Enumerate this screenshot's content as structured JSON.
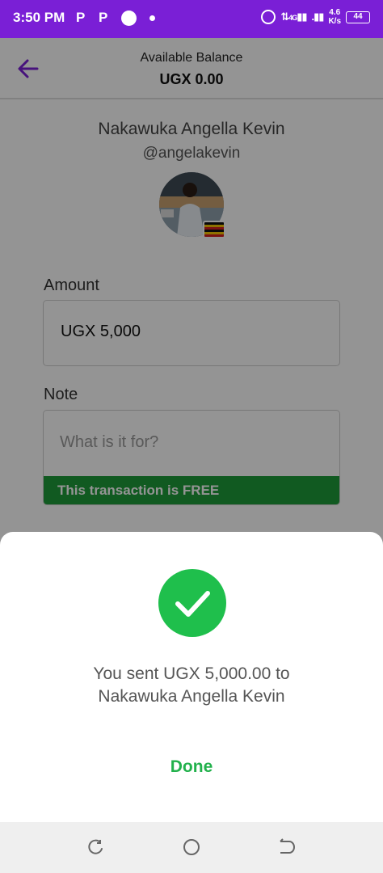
{
  "status_bar": {
    "time": "3:50 PM",
    "p1": "P",
    "p2": "P",
    "network": "4G",
    "speed_value": "4.6",
    "speed_unit": "K/s",
    "battery": "44"
  },
  "header": {
    "balance_label": "Available Balance",
    "balance_value": "UGX 0.00"
  },
  "recipient": {
    "name": "Nakawuka Angella Kevin",
    "handle": "@angelakevin"
  },
  "form": {
    "amount_label": "Amount",
    "amount_value": "UGX 5,000",
    "note_label": "Note",
    "note_placeholder": "What is it for?",
    "free_notice": "This transaction is FREE"
  },
  "dialog": {
    "message_line1": "You sent UGX 5,000.00 to",
    "message_line2": "Nakawuka Angella Kevin",
    "done_label": "Done"
  },
  "colors": {
    "status_bar": "#7a1fd6",
    "accent": "#7a1fd6",
    "success": "#1fbf4c",
    "free_bar": "#1e9c3a"
  }
}
